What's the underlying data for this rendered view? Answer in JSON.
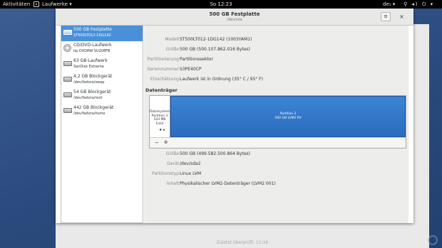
{
  "topbar": {
    "activities": "Aktivitäten",
    "app_name": "Laufwerke ▾",
    "clock": "So 12:23",
    "keyboard": "de₁ ▾",
    "tray_icons": "⚲ ◂) ⏻ ▾"
  },
  "window": {
    "title": "500 GB Festplatte",
    "subtitle": "/dev/sda",
    "menu_icon": "≡",
    "close_icon": "×"
  },
  "sidebar": {
    "items": [
      {
        "name": "500 GB Festplatte",
        "sub": "ST500LT012-1DG142",
        "icon": "harddisk-icon",
        "selected": true
      },
      {
        "name": "CD/DVD-Laufwerk",
        "sub": "hp      DVDRW  SU208FB",
        "icon": "optical-drive-icon",
        "selected": false
      },
      {
        "name": "63 GB-Laufwerk",
        "sub": "SanDisk Extreme",
        "icon": "usb-drive-icon",
        "selected": false
      },
      {
        "name": "4,2 GB Blockgerät",
        "sub": "/dev/fedora/swap",
        "icon": "block-device-icon",
        "selected": false
      },
      {
        "name": "54 GB Blockgerät",
        "sub": "/dev/fedora/root",
        "icon": "block-device-icon",
        "selected": false
      },
      {
        "name": "442 GB Blockgerät",
        "sub": "/dev/fedora/home",
        "icon": "block-device-icon",
        "selected": false
      }
    ]
  },
  "drive_info": [
    {
      "label": "Modell",
      "value": "ST500LT012-1DG142 (1003YAM1)"
    },
    {
      "label": "Größe",
      "value": "500 GB (500.107.862.016 Bytes)"
    },
    {
      "label": "Partitionierung",
      "value": "Partitionssektor"
    },
    {
      "label": "Seriennummer",
      "value": "S3PE40CP"
    },
    {
      "label": "Einschätzung",
      "value": "Laufwerk ist in Ordnung (35° C / 95° F)"
    }
  ],
  "volumes": {
    "title": "Datenträger",
    "partition1": {
      "line1": "Dateisystem",
      "line2": "Partition 1",
      "line3": "524 MB Ext4"
    },
    "partition1_icons": "★ ▸",
    "partition2": {
      "line1": "Partition 2",
      "line2": "500 GB LVM2 PV"
    },
    "tool_minus": "−",
    "tool_gear": "⚙"
  },
  "partition_info": [
    {
      "label": "Größe",
      "value": "500 GB (499.582.500.864 Bytes)"
    },
    {
      "label": "Gerät",
      "value": "/dev/sda2"
    },
    {
      "label": "Partitionstyp",
      "value": "Linux LVM"
    },
    {
      "label": "Inhalt",
      "value": "Physikalischer LVM2-Datenträger (LVM2 001)"
    }
  ],
  "background": {
    "footer": "Zuletzt überprüft: 11:16"
  },
  "colors": {
    "selection": "#4a90d9",
    "partition_blue": "#2f74c6",
    "topbar": "#000000"
  }
}
